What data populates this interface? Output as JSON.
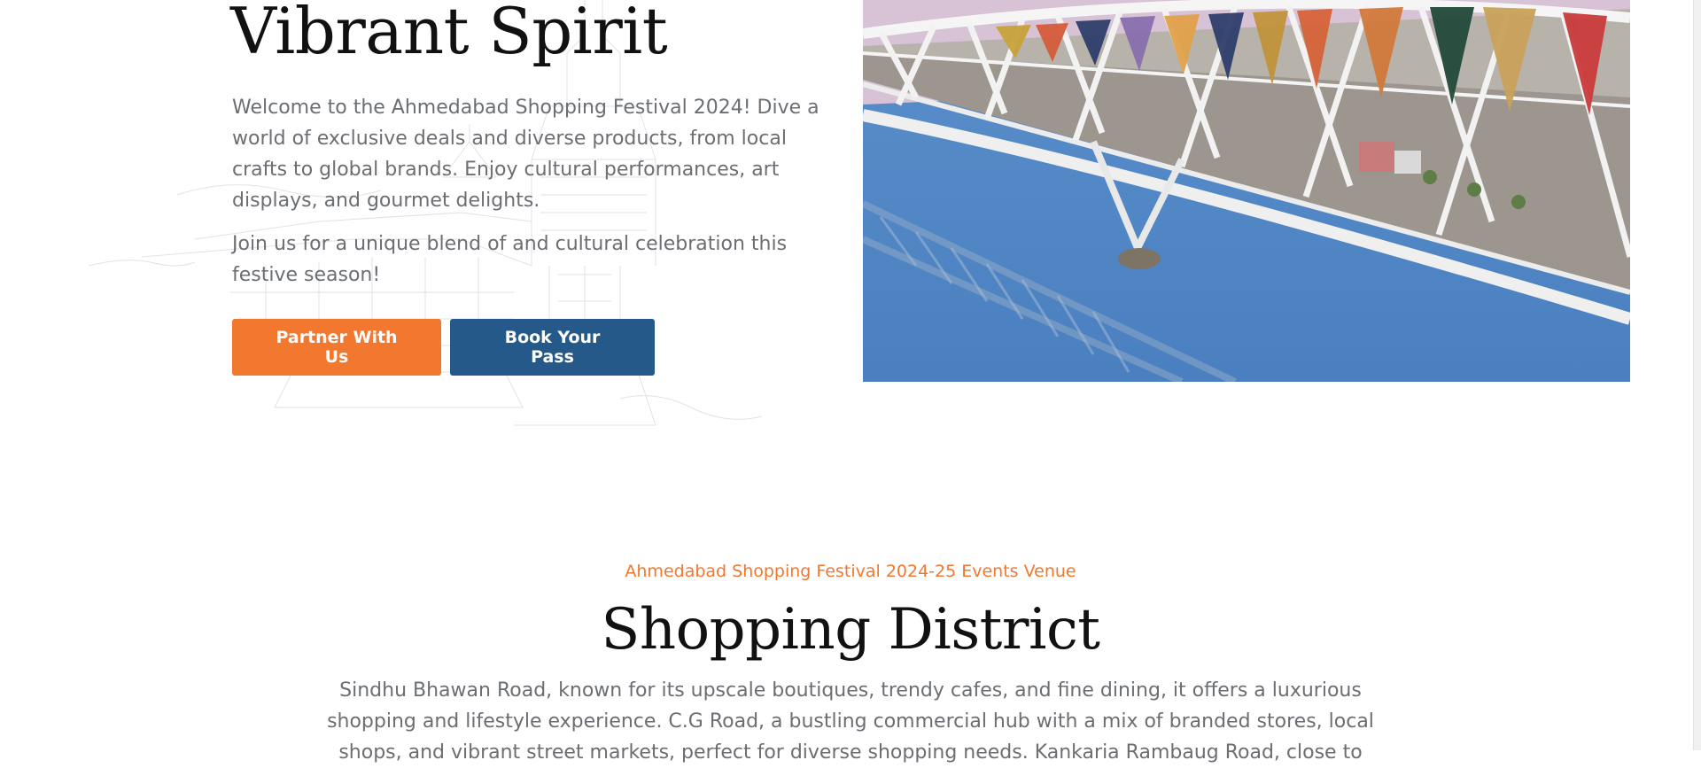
{
  "hero": {
    "title": "Vibrant Spirit",
    "paragraph_1": "Welcome to the Ahmedabad Shopping Festival 2024! Dive a world of exclusive deals and diverse products, from local crafts to global brands. Enjoy cultural performances, art displays, and gourmet delights.",
    "paragraph_2": "Join us for a unique blend of and cultural celebration this festive season!",
    "partner_button_label": "Partner With Us",
    "pass_button_label": "Book Your Pass",
    "image_icon": "bridge-photo"
  },
  "venue": {
    "eyebrow": "Ahmedabad Shopping Festival 2024-25 Events Venue",
    "title": "Shopping District",
    "description": "Sindhu Bhawan Road, known for its upscale boutiques, trendy cafes, and fine dining, it offers a luxurious shopping and lifestyle experience. C.G Road, a bustling commercial hub with a mix of branded stores, local shops, and vibrant street markets, perfect for diverse shopping needs. Kankaria Rambaug Road, close to"
  },
  "colors": {
    "accent_orange": "#f2772f",
    "accent_blue": "#245989",
    "body_text": "#6b6e72",
    "heading_text": "#111111",
    "river_blue": "#4f86c6",
    "sky_pink": "#d7c2d6"
  }
}
